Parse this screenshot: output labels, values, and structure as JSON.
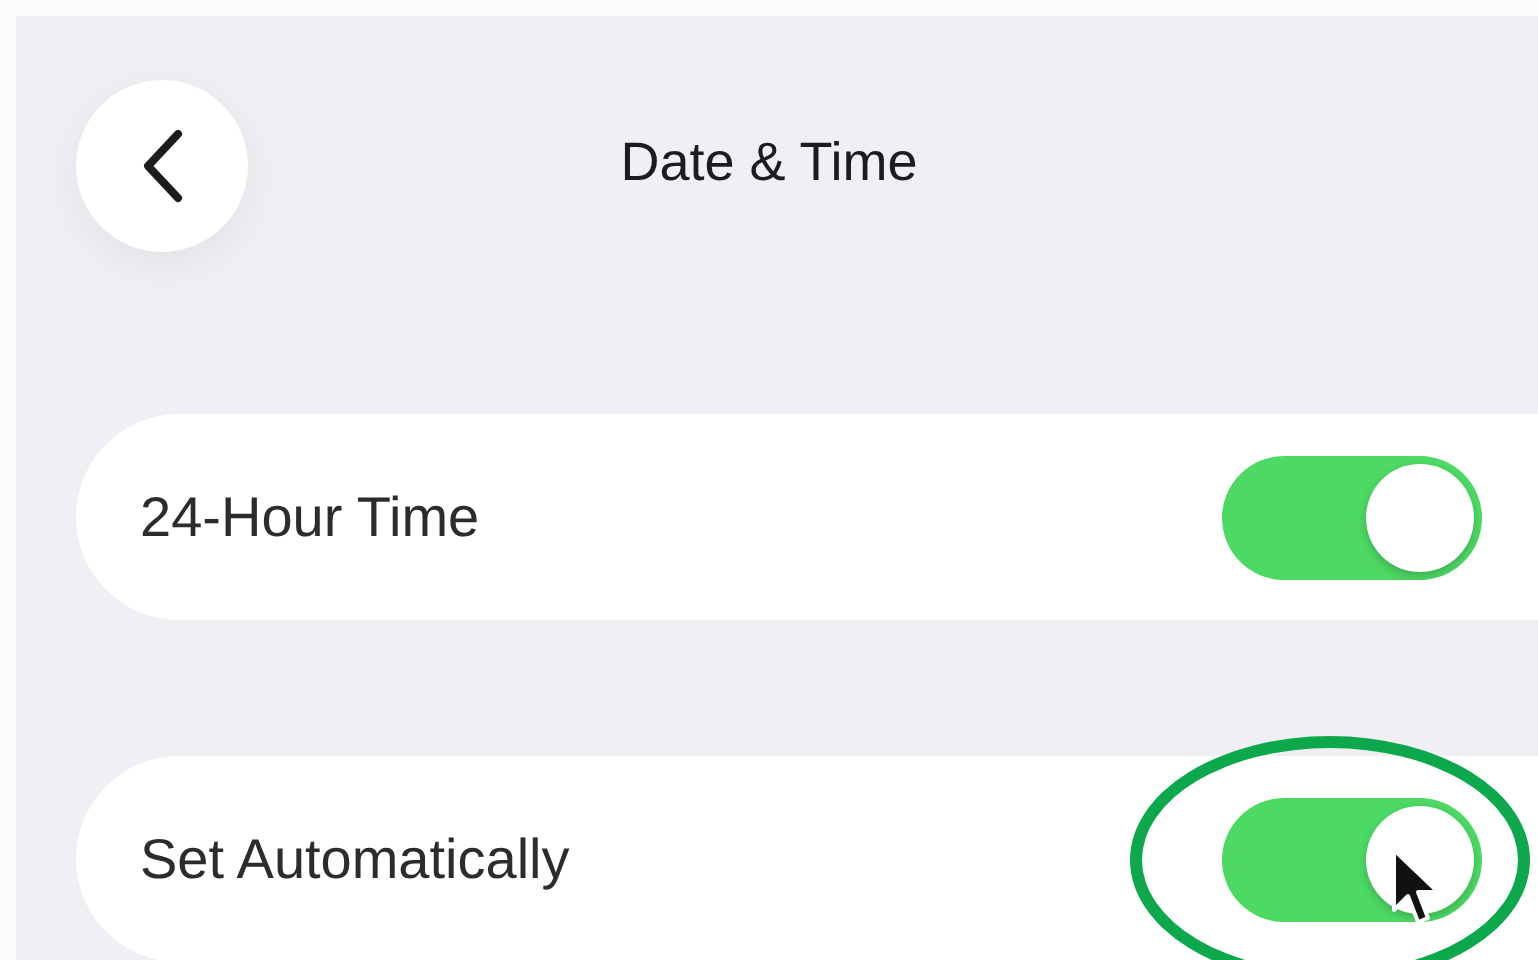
{
  "header": {
    "title": "Date & Time"
  },
  "settings": [
    {
      "label": "24-Hour Time",
      "on": true
    },
    {
      "label": "Set Automatically",
      "on": true
    }
  ]
}
